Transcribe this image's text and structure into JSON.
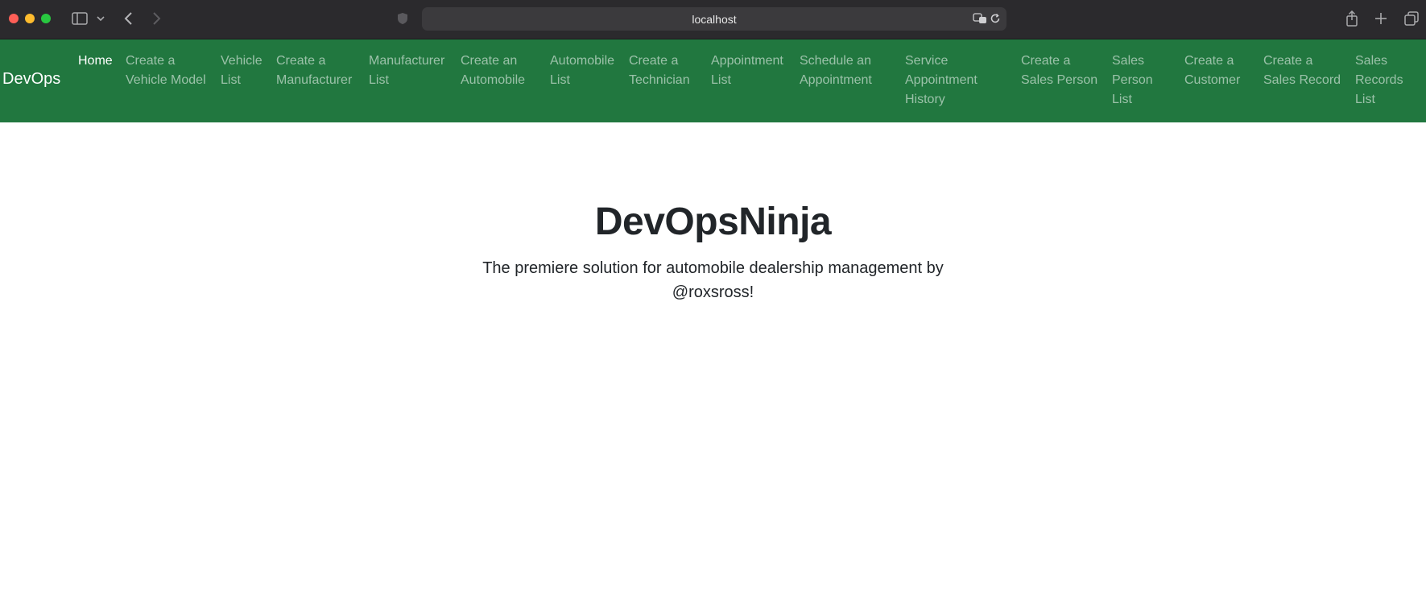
{
  "browser": {
    "url": "localhost"
  },
  "navbar": {
    "brand": "DevOps",
    "bg_color": "#21773f",
    "items": [
      {
        "label": "Home",
        "active": true
      },
      {
        "label": "Create a\nVehicle Model"
      },
      {
        "label": "Vehicle\nList"
      },
      {
        "label": "Create a\nManufacturer"
      },
      {
        "label": "Manufacturer\nList"
      },
      {
        "label": "Create an\nAutomobile"
      },
      {
        "label": "Automobile\nList"
      },
      {
        "label": "Create a\nTechnician"
      },
      {
        "label": "Appointment\nList"
      },
      {
        "label": "Schedule an\nAppointment"
      },
      {
        "label": "Service\nAppointment\nHistory"
      },
      {
        "label": "Create a\nSales Person"
      },
      {
        "label": "Sales\nPerson\nList"
      },
      {
        "label": "Create a\nCustomer"
      },
      {
        "label": "Create a\nSales Record"
      },
      {
        "label": "Sales\nRecords\nList"
      }
    ]
  },
  "hero": {
    "title": "DevOpsNinja",
    "subtitle": "The premiere solution for automobile dealership management by @roxsross!"
  }
}
